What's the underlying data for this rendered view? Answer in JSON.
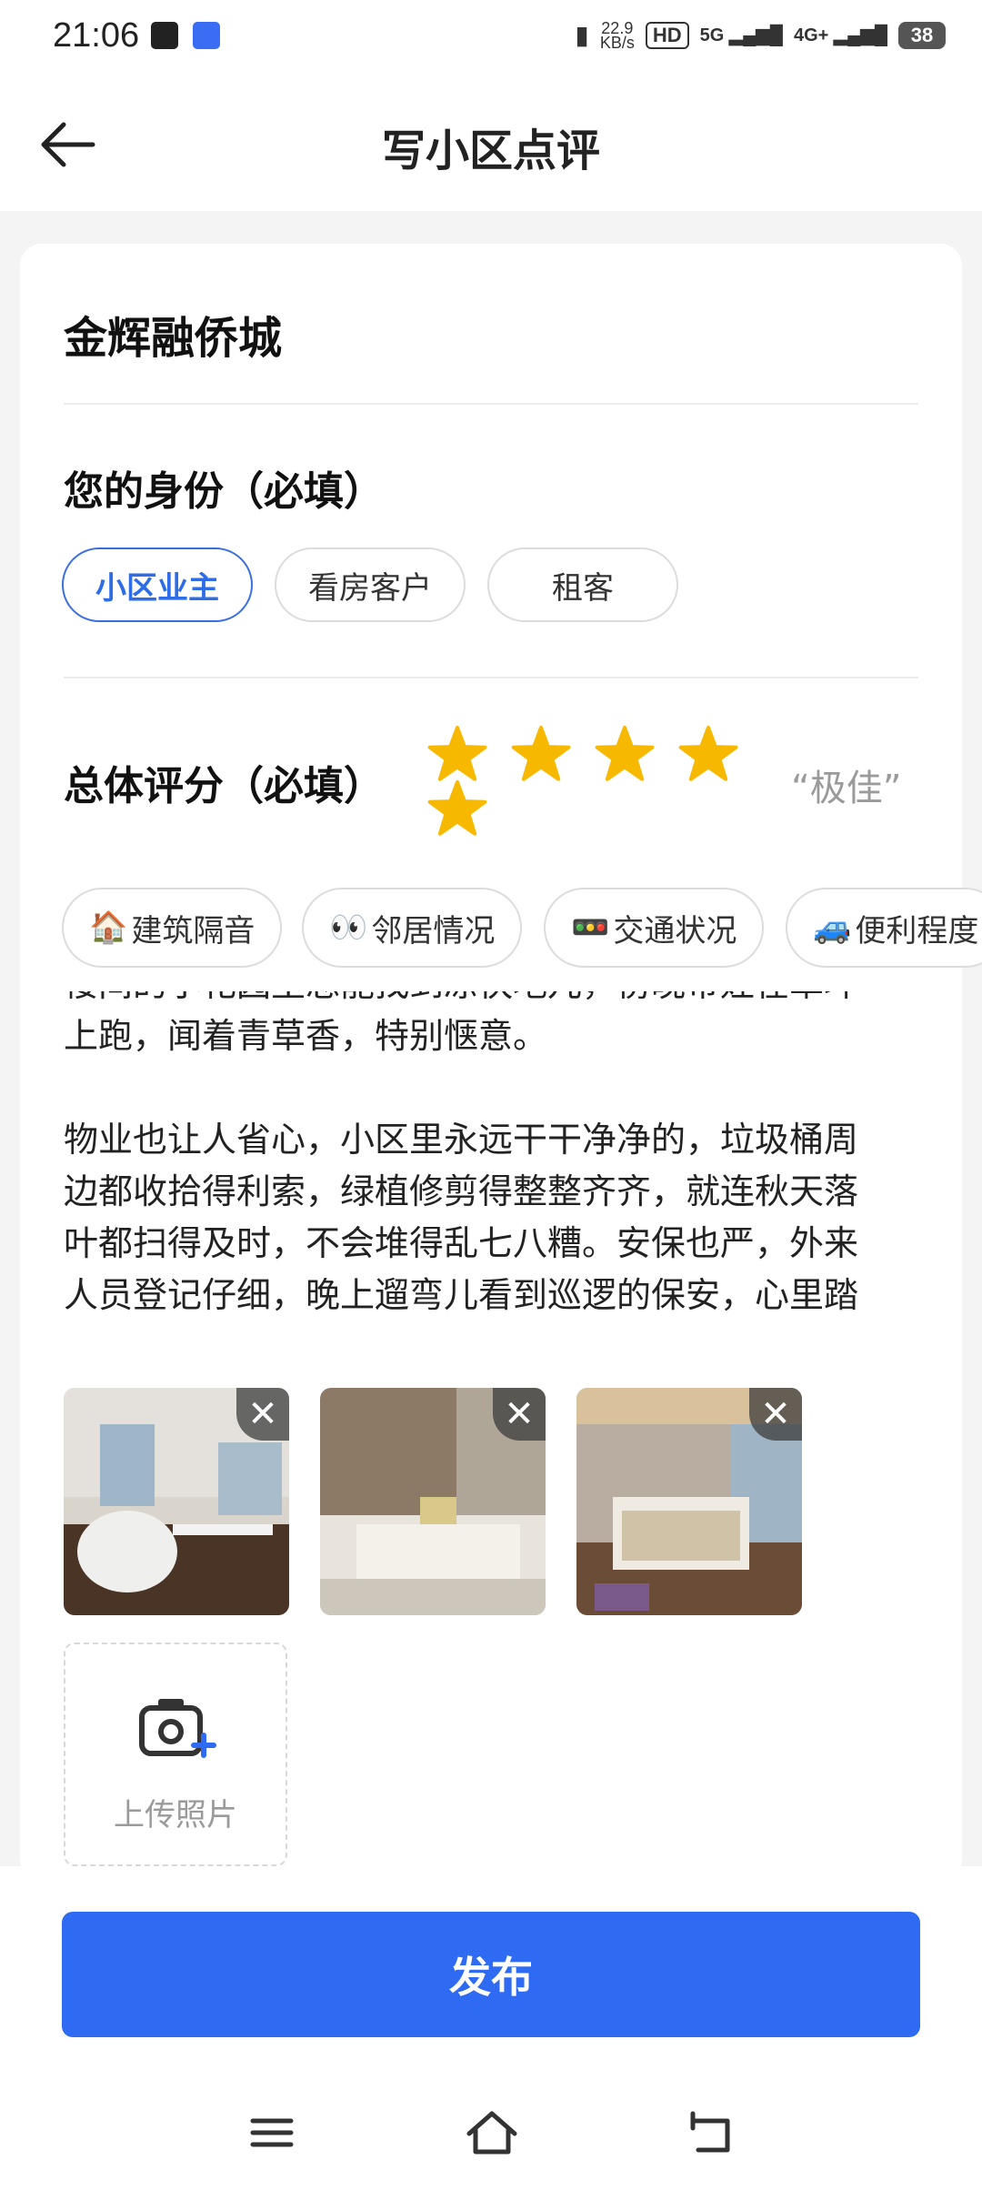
{
  "status_bar": {
    "time": "21:06",
    "net_speed_top": "22.9",
    "net_speed_bottom": "KB/s",
    "hd": "HD",
    "sim1": "5G",
    "sim2": "4G+",
    "battery": "38"
  },
  "header": {
    "title": "写小区点评"
  },
  "community_name": "金辉融侨城",
  "identity": {
    "title": "您的身份（必填）",
    "options": [
      "小区业主",
      "看房客户",
      "租客"
    ],
    "selected": "小区业主"
  },
  "rating": {
    "title": "总体评分（必填）",
    "value": 5,
    "max": 5,
    "label": "“极佳”"
  },
  "tags": [
    {
      "emoji": "🏠",
      "label": "建筑隔音"
    },
    {
      "emoji": "👀",
      "label": "邻居情况"
    },
    {
      "emoji": "🚥",
      "label": "交通状况"
    },
    {
      "emoji": "🚙",
      "label": "便利程度"
    }
  ],
  "review": {
    "lines_p1": [
      "楼间的小花园里总能找到凉快地儿，傍晚带娃在草坪",
      "上跑，闻着青草香，特别惬意。"
    ],
    "lines_p2": [
      "物业也让人省心，小区里永远干干净净的，垃圾桶周",
      "边都收拾得利索，绿植修剪得整整齐齐，就连秋天落",
      "叶都扫得及时，不会堆得乱七八糟。安保也严，外来",
      "人员登记仔细，晚上遛弯儿看到巡逻的保安，心里踏"
    ]
  },
  "photos": [
    {
      "name": "bedroom-photo"
    },
    {
      "name": "bathroom-photo"
    },
    {
      "name": "bed-frame-photo"
    }
  ],
  "upload": {
    "label": "上传照片",
    "icon": "camera-plus-icon"
  },
  "publish_label": "发布",
  "colors": {
    "accent": "#2f6bf2",
    "star": "#f7b800"
  }
}
